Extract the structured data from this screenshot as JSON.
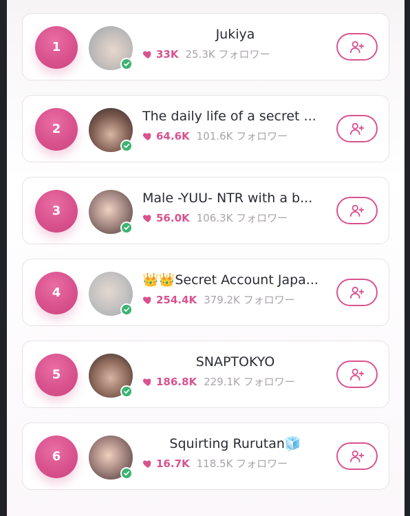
{
  "follow_suffix": "フォロワー",
  "colors": {
    "accent": "#d9528e",
    "verified": "#3cb371",
    "text": "#2a2b33",
    "muted": "#a8a3a8"
  },
  "icons": {
    "like": "heart-icon",
    "verified": "check-icon",
    "follow": "user-plus-icon"
  },
  "creators": [
    {
      "rank": "1",
      "name": "Jukiya",
      "likes": "33K",
      "followers": "25.3K フォロワー"
    },
    {
      "rank": "2",
      "name": "The daily life of a secret ...",
      "likes": "64.6K",
      "followers": "101.6K フォロワー"
    },
    {
      "rank": "3",
      "name": "Male -YUU- NTR with a b...",
      "likes": "56.0K",
      "followers": "106.3K フォロワー"
    },
    {
      "rank": "4",
      "name": "👑👑Secret Account Japa...",
      "likes": "254.4K",
      "followers": "379.2K フォロワー"
    },
    {
      "rank": "5",
      "name": "SNAPTOKYO",
      "likes": "186.8K",
      "followers": "229.1K フォロワー"
    },
    {
      "rank": "6",
      "name": "Squirting Rurutan🧊",
      "likes": "16.7K",
      "followers": "118.5K フォロワー"
    }
  ]
}
